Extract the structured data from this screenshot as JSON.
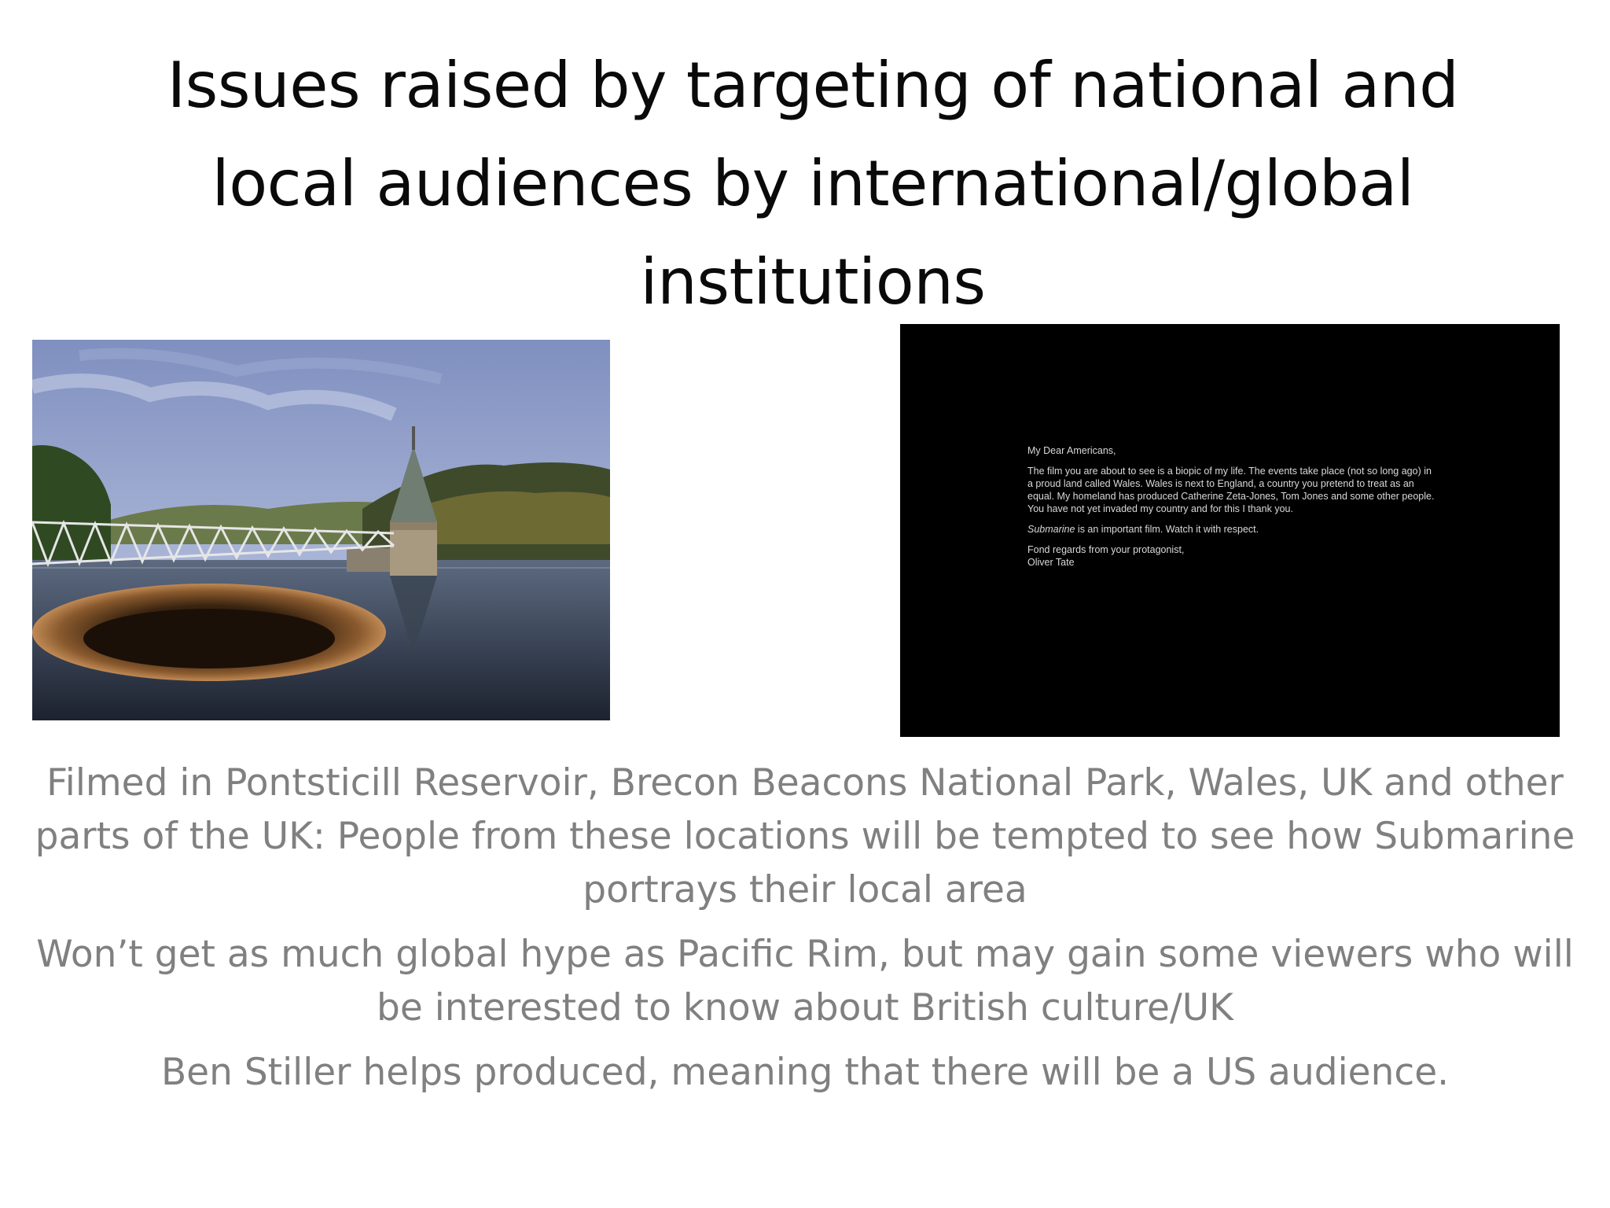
{
  "slide": {
    "title": "Issues raised by targeting of national and local audiences by international/global institutions",
    "bullets": [
      "Filmed in Pontsticill Reservoir, Brecon Beacons National Park, Wales, UK and other parts of the UK: People from these locations will be tempted to see how Submarine portrays their local area",
      "Won’t get as much global hype as Pacific Rim, but may gain some viewers who will be interested to know about British culture/UK",
      "Ben Stiller helps produced, meaning that there will be a US audience."
    ]
  },
  "letter_image": {
    "salutation": "My Dear Americans,",
    "paragraph": "The film you are about to see is a biopic of my life. The events take place (not so long ago) in a proud land called Wales. Wales is next to England, a country you pretend to treat as an equal. My homeland has produced Catherine Zeta-Jones, Tom Jones and some other people. You have not yet invaded my country and for this I thank you.",
    "film_name": "Submarine",
    "note_rest": " is an important film. Watch it with respect.",
    "closing": "Fond regards from your protagonist,",
    "signature": "Oliver Tate"
  },
  "colors": {
    "title": "#0a0a0a",
    "body_text": "#808080",
    "letter_background": "#000000",
    "letter_text": "#d9d9d9"
  }
}
